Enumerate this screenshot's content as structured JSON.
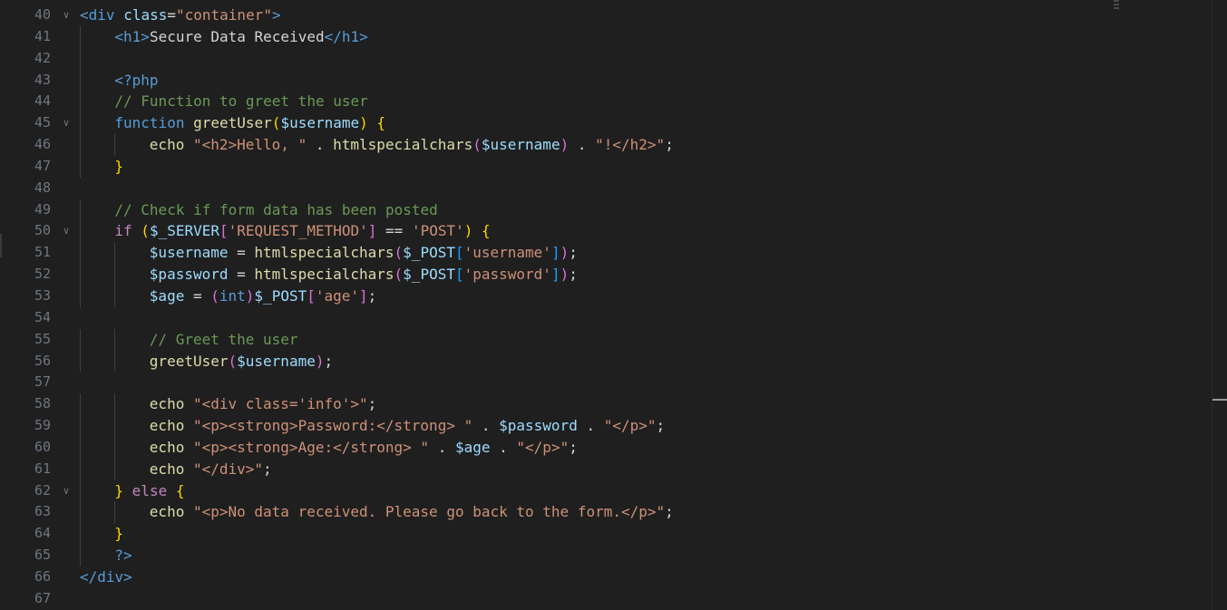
{
  "colors": {
    "background": "#1f1f1f",
    "line_number": "#6e7681",
    "tag": "#569cd6",
    "attribute": "#9cdcfe",
    "string": "#ce9178",
    "keyword": "#569cd6",
    "control": "#c586c0",
    "function": "#dcdcaa",
    "variable": "#9cdcfe",
    "comment": "#6a9955",
    "bracket_level1": "#ffd700",
    "bracket_level2": "#da70d6",
    "bracket_level3": "#179fff"
  },
  "icons": {
    "fold": "chevron-down-icon"
  },
  "editor": {
    "lines": [
      {
        "number": "40",
        "fold": true,
        "indent": 0,
        "tokens": [
          {
            "t": "<",
            "c": "t-tag"
          },
          {
            "t": "div",
            "c": "t-tag"
          },
          {
            "t": " ",
            "c": "t-text"
          },
          {
            "t": "class",
            "c": "t-attr"
          },
          {
            "t": "=",
            "c": "t-text"
          },
          {
            "t": "\"container\"",
            "c": "t-str"
          },
          {
            "t": ">",
            "c": "t-tag"
          }
        ]
      },
      {
        "number": "41",
        "fold": false,
        "indent": 1,
        "tokens": [
          {
            "t": "<",
            "c": "t-tag"
          },
          {
            "t": "h1",
            "c": "t-tag"
          },
          {
            "t": ">",
            "c": "t-tag"
          },
          {
            "t": "Secure Data Received",
            "c": "t-text"
          },
          {
            "t": "</",
            "c": "t-tag"
          },
          {
            "t": "h1",
            "c": "t-tag"
          },
          {
            "t": ">",
            "c": "t-tag"
          }
        ]
      },
      {
        "number": "42",
        "fold": false,
        "indent": 0,
        "tokens": []
      },
      {
        "number": "43",
        "fold": false,
        "indent": 1,
        "tokens": [
          {
            "t": "<?php",
            "c": "t-php"
          }
        ]
      },
      {
        "number": "44",
        "fold": false,
        "indent": 1,
        "tokens": [
          {
            "t": "// Function to greet the user",
            "c": "t-com"
          }
        ]
      },
      {
        "number": "45",
        "fold": true,
        "indent": 1,
        "tokens": [
          {
            "t": "function",
            "c": "t-kw"
          },
          {
            "t": " ",
            "c": "t-text"
          },
          {
            "t": "greetUser",
            "c": "t-fn"
          },
          {
            "t": "(",
            "c": "t-br1"
          },
          {
            "t": "$username",
            "c": "t-var"
          },
          {
            "t": ")",
            "c": "t-br1"
          },
          {
            "t": " ",
            "c": "t-text"
          },
          {
            "t": "{",
            "c": "t-br1"
          }
        ]
      },
      {
        "number": "46",
        "fold": false,
        "indent": 2,
        "tokens": [
          {
            "t": "echo",
            "c": "t-fn"
          },
          {
            "t": " ",
            "c": "t-text"
          },
          {
            "t": "\"<h2>Hello, \"",
            "c": "t-str"
          },
          {
            "t": " . ",
            "c": "t-op"
          },
          {
            "t": "htmlspecialchars",
            "c": "t-fn"
          },
          {
            "t": "(",
            "c": "t-br2"
          },
          {
            "t": "$username",
            "c": "t-var"
          },
          {
            "t": ")",
            "c": "t-br2"
          },
          {
            "t": " . ",
            "c": "t-op"
          },
          {
            "t": "\"!</h2>\"",
            "c": "t-str"
          },
          {
            "t": ";",
            "c": "t-text"
          }
        ]
      },
      {
        "number": "47",
        "fold": false,
        "indent": 1,
        "tokens": [
          {
            "t": "}",
            "c": "t-br1"
          }
        ]
      },
      {
        "number": "48",
        "fold": false,
        "indent": 0,
        "tokens": []
      },
      {
        "number": "49",
        "fold": false,
        "indent": 1,
        "tokens": [
          {
            "t": "// Check if form data has been posted",
            "c": "t-com"
          }
        ]
      },
      {
        "number": "50",
        "fold": true,
        "indent": 1,
        "tokens": [
          {
            "t": "if",
            "c": "t-ctl"
          },
          {
            "t": " ",
            "c": "t-text"
          },
          {
            "t": "(",
            "c": "t-br1"
          },
          {
            "t": "$_SERVER",
            "c": "t-var"
          },
          {
            "t": "[",
            "c": "t-br2"
          },
          {
            "t": "'REQUEST_METHOD'",
            "c": "t-str"
          },
          {
            "t": "]",
            "c": "t-br2"
          },
          {
            "t": " == ",
            "c": "t-op"
          },
          {
            "t": "'POST'",
            "c": "t-str"
          },
          {
            "t": ")",
            "c": "t-br1"
          },
          {
            "t": " ",
            "c": "t-text"
          },
          {
            "t": "{",
            "c": "t-br1"
          }
        ]
      },
      {
        "number": "51",
        "fold": false,
        "indent": 2,
        "tokens": [
          {
            "t": "$username",
            "c": "t-var"
          },
          {
            "t": " = ",
            "c": "t-op"
          },
          {
            "t": "htmlspecialchars",
            "c": "t-fn"
          },
          {
            "t": "(",
            "c": "t-br2"
          },
          {
            "t": "$_POST",
            "c": "t-var"
          },
          {
            "t": "[",
            "c": "t-br3"
          },
          {
            "t": "'username'",
            "c": "t-str"
          },
          {
            "t": "]",
            "c": "t-br3"
          },
          {
            "t": ")",
            "c": "t-br2"
          },
          {
            "t": ";",
            "c": "t-text"
          }
        ]
      },
      {
        "number": "52",
        "fold": false,
        "indent": 2,
        "tokens": [
          {
            "t": "$password",
            "c": "t-var"
          },
          {
            "t": " = ",
            "c": "t-op"
          },
          {
            "t": "htmlspecialchars",
            "c": "t-fn"
          },
          {
            "t": "(",
            "c": "t-br2"
          },
          {
            "t": "$_POST",
            "c": "t-var"
          },
          {
            "t": "[",
            "c": "t-br3"
          },
          {
            "t": "'password'",
            "c": "t-str"
          },
          {
            "t": "]",
            "c": "t-br3"
          },
          {
            "t": ")",
            "c": "t-br2"
          },
          {
            "t": ";",
            "c": "t-text"
          }
        ]
      },
      {
        "number": "53",
        "fold": false,
        "indent": 2,
        "tokens": [
          {
            "t": "$age",
            "c": "t-var"
          },
          {
            "t": " = ",
            "c": "t-op"
          },
          {
            "t": "(",
            "c": "t-br2"
          },
          {
            "t": "int",
            "c": "t-kw"
          },
          {
            "t": ")",
            "c": "t-br2"
          },
          {
            "t": "$_POST",
            "c": "t-var"
          },
          {
            "t": "[",
            "c": "t-br2"
          },
          {
            "t": "'age'",
            "c": "t-str"
          },
          {
            "t": "]",
            "c": "t-br2"
          },
          {
            "t": ";",
            "c": "t-text"
          }
        ]
      },
      {
        "number": "54",
        "fold": false,
        "indent": 0,
        "tokens": []
      },
      {
        "number": "55",
        "fold": false,
        "indent": 2,
        "tokens": [
          {
            "t": "// Greet the user",
            "c": "t-com"
          }
        ]
      },
      {
        "number": "56",
        "fold": false,
        "indent": 2,
        "tokens": [
          {
            "t": "greetUser",
            "c": "t-fn"
          },
          {
            "t": "(",
            "c": "t-br2"
          },
          {
            "t": "$username",
            "c": "t-var"
          },
          {
            "t": ")",
            "c": "t-br2"
          },
          {
            "t": ";",
            "c": "t-text"
          }
        ]
      },
      {
        "number": "57",
        "fold": false,
        "indent": 0,
        "tokens": []
      },
      {
        "number": "58",
        "fold": false,
        "indent": 2,
        "tokens": [
          {
            "t": "echo",
            "c": "t-fn"
          },
          {
            "t": " ",
            "c": "t-text"
          },
          {
            "t": "\"<div class='info'>\"",
            "c": "t-str"
          },
          {
            "t": ";",
            "c": "t-text"
          }
        ]
      },
      {
        "number": "59",
        "fold": false,
        "indent": 2,
        "tokens": [
          {
            "t": "echo",
            "c": "t-fn"
          },
          {
            "t": " ",
            "c": "t-text"
          },
          {
            "t": "\"<p><strong>Password:</strong> \"",
            "c": "t-str"
          },
          {
            "t": " . ",
            "c": "t-op"
          },
          {
            "t": "$password",
            "c": "t-var"
          },
          {
            "t": " . ",
            "c": "t-op"
          },
          {
            "t": "\"</p>\"",
            "c": "t-str"
          },
          {
            "t": ";",
            "c": "t-text"
          }
        ]
      },
      {
        "number": "60",
        "fold": false,
        "indent": 2,
        "tokens": [
          {
            "t": "echo",
            "c": "t-fn"
          },
          {
            "t": " ",
            "c": "t-text"
          },
          {
            "t": "\"<p><strong>Age:</strong> \"",
            "c": "t-str"
          },
          {
            "t": " . ",
            "c": "t-op"
          },
          {
            "t": "$age",
            "c": "t-var"
          },
          {
            "t": " . ",
            "c": "t-op"
          },
          {
            "t": "\"</p>\"",
            "c": "t-str"
          },
          {
            "t": ";",
            "c": "t-text"
          }
        ]
      },
      {
        "number": "61",
        "fold": false,
        "indent": 2,
        "tokens": [
          {
            "t": "echo",
            "c": "t-fn"
          },
          {
            "t": " ",
            "c": "t-text"
          },
          {
            "t": "\"</div>\"",
            "c": "t-str"
          },
          {
            "t": ";",
            "c": "t-text"
          }
        ]
      },
      {
        "number": "62",
        "fold": true,
        "indent": 1,
        "tokens": [
          {
            "t": "}",
            "c": "t-br1"
          },
          {
            "t": " ",
            "c": "t-text"
          },
          {
            "t": "else",
            "c": "t-ctl"
          },
          {
            "t": " ",
            "c": "t-text"
          },
          {
            "t": "{",
            "c": "t-br1"
          }
        ]
      },
      {
        "number": "63",
        "fold": false,
        "indent": 2,
        "tokens": [
          {
            "t": "echo",
            "c": "t-fn"
          },
          {
            "t": " ",
            "c": "t-text"
          },
          {
            "t": "\"<p>No data received. Please go back to the form.</p>\"",
            "c": "t-str"
          },
          {
            "t": ";",
            "c": "t-text"
          }
        ]
      },
      {
        "number": "64",
        "fold": false,
        "indent": 1,
        "tokens": [
          {
            "t": "}",
            "c": "t-br1"
          }
        ]
      },
      {
        "number": "65",
        "fold": false,
        "indent": 1,
        "tokens": [
          {
            "t": "?>",
            "c": "t-php"
          }
        ]
      },
      {
        "number": "66",
        "fold": false,
        "indent": 0,
        "tokens": [
          {
            "t": "</",
            "c": "t-tag"
          },
          {
            "t": "div",
            "c": "t-tag"
          },
          {
            "t": ">",
            "c": "t-tag"
          }
        ]
      },
      {
        "number": "67",
        "fold": false,
        "indent": 0,
        "tokens": []
      }
    ]
  }
}
